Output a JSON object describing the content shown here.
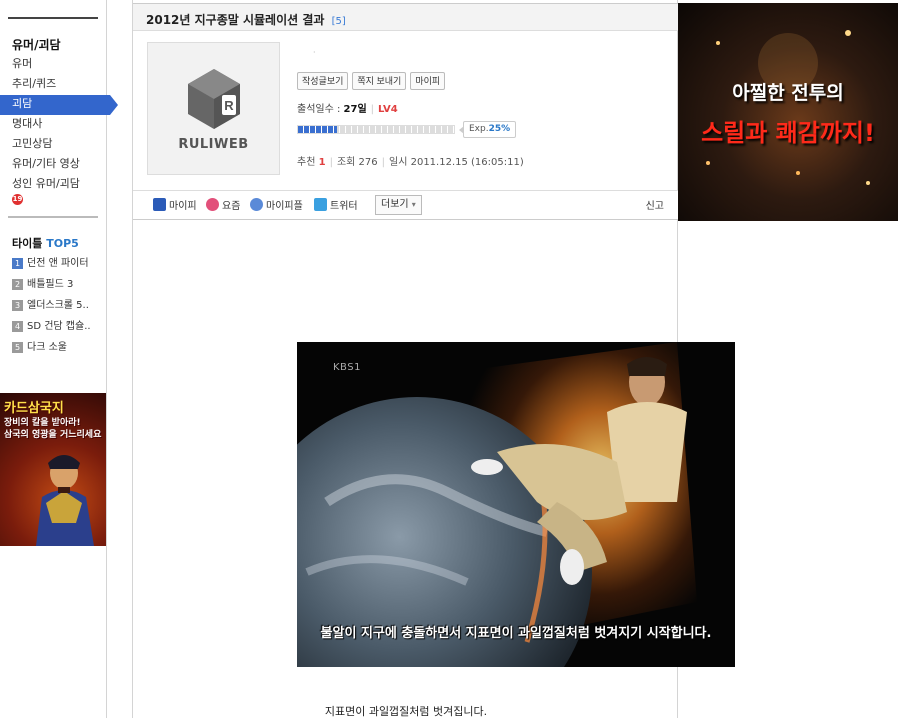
{
  "sidebar": {
    "category_title": "유머/괴담",
    "categories": [
      {
        "label": "유머"
      },
      {
        "label": "추리/퀴즈"
      },
      {
        "label": "괴담"
      },
      {
        "label": "명대사"
      },
      {
        "label": "고민상담"
      },
      {
        "label": "유머/기타 영상"
      },
      {
        "label": "성인 유머/괴담"
      }
    ],
    "active_category": "괴담",
    "age_badge": "19",
    "top5": {
      "title": "타이틀",
      "title_accent": "TOP5",
      "items": [
        {
          "rank": "1",
          "label": "던전 앤 파이터"
        },
        {
          "rank": "2",
          "label": "배틀필드 3"
        },
        {
          "rank": "3",
          "label": "엘더스크롤 5.."
        },
        {
          "rank": "4",
          "label": "SD 건담 캡슐.."
        },
        {
          "rank": "5",
          "label": "다크 소울"
        }
      ]
    },
    "ad": {
      "title": "카드삼국지",
      "line1": "장비의 칼을 받아라!",
      "line2": "삼국의 영광을 거느리세요"
    }
  },
  "post": {
    "title": "2012년 지구종말 시뮬레이션 결과",
    "comment_count": "[5]",
    "avatar_logo": "RULIWEB",
    "nickname": "·",
    "buttons": {
      "view_posts": "작성글보기",
      "send_note": "쪽지 보내기",
      "mypi": "마이피"
    },
    "attendance_label": "출석일수 :",
    "attendance_value": "27일",
    "level": "LV4",
    "exp_label": "Exp.",
    "exp_percent": "25%",
    "exp_fraction": 0.25,
    "recommend_label": "추천",
    "recommend_value": "1",
    "views_label": "조회",
    "views_value": "276",
    "date_label": "일시",
    "date_value": "2011.12.15 (16:05:11)",
    "image_caption": "불알이 지구에 충돌하면서 지표면이 과일껍질처럼 벗겨지기 시작합니다.",
    "image_channel": "KBS1",
    "body_text": "지표면이 과일껍질처럼 벗겨집니다."
  },
  "share": {
    "mypi": "마이피",
    "yozm": "요즘",
    "mypeople": "마이피플",
    "twitter": "트위터",
    "more": "더보기",
    "report": "신고"
  },
  "right_ad": {
    "line1": "아찔한 전투의",
    "line2": "스릴과 쾌감까지!"
  },
  "colors": {
    "accent_blue": "#3366cc",
    "level_red": "#e04040",
    "exp_blue": "#2a78c8"
  }
}
